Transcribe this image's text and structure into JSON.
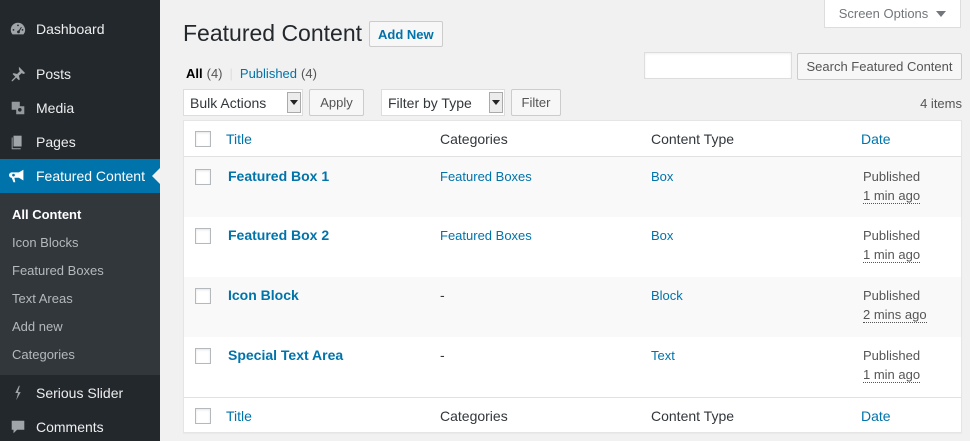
{
  "sidebar": {
    "menu": [
      {
        "label": "Dashboard",
        "icon": "dashboard-icon"
      },
      {
        "label": "Posts",
        "icon": "pin-icon"
      },
      {
        "label": "Media",
        "icon": "media-icon"
      },
      {
        "label": "Pages",
        "icon": "pages-icon"
      },
      {
        "label": "Featured Content",
        "icon": "megaphone-icon"
      },
      {
        "label": "Serious Slider",
        "icon": "slider-icon"
      },
      {
        "label": "Comments",
        "icon": "comment-icon"
      }
    ],
    "submenu": [
      "All Content",
      "Icon Blocks",
      "Featured Boxes",
      "Text Areas",
      "Add new",
      "Categories"
    ]
  },
  "screen_options": "Screen Options",
  "page": {
    "title": "Featured Content",
    "add_new": "Add New"
  },
  "views": {
    "all_label": "All",
    "all_count": "(4)",
    "separator": "|",
    "published_label": "Published",
    "published_count": "(4)"
  },
  "search": {
    "value": "",
    "button": "Search Featured Content"
  },
  "filters": {
    "bulk_actions": "Bulk Actions",
    "apply": "Apply",
    "filter_by_type": "Filter by Type",
    "filter": "Filter",
    "items_count": "4 items"
  },
  "table": {
    "columns": {
      "title": "Title",
      "categories": "Categories",
      "content_type": "Content Type",
      "date": "Date"
    },
    "rows": [
      {
        "title": "Featured Box 1",
        "category": "Featured Boxes",
        "type": "Box",
        "status": "Published",
        "time": "1 min ago"
      },
      {
        "title": "Featured Box 2",
        "category": "Featured Boxes",
        "type": "Box",
        "status": "Published",
        "time": "1 min ago"
      },
      {
        "title": "Icon Block",
        "category": "-",
        "type": "Block",
        "status": "Published",
        "time": "2 mins ago"
      },
      {
        "title": "Special Text Area",
        "category": "-",
        "type": "Text",
        "status": "Published",
        "time": "1 min ago"
      }
    ]
  },
  "colors": {
    "accent": "#0073aa",
    "sidebar": "#23282d",
    "submenu": "#32373c"
  }
}
